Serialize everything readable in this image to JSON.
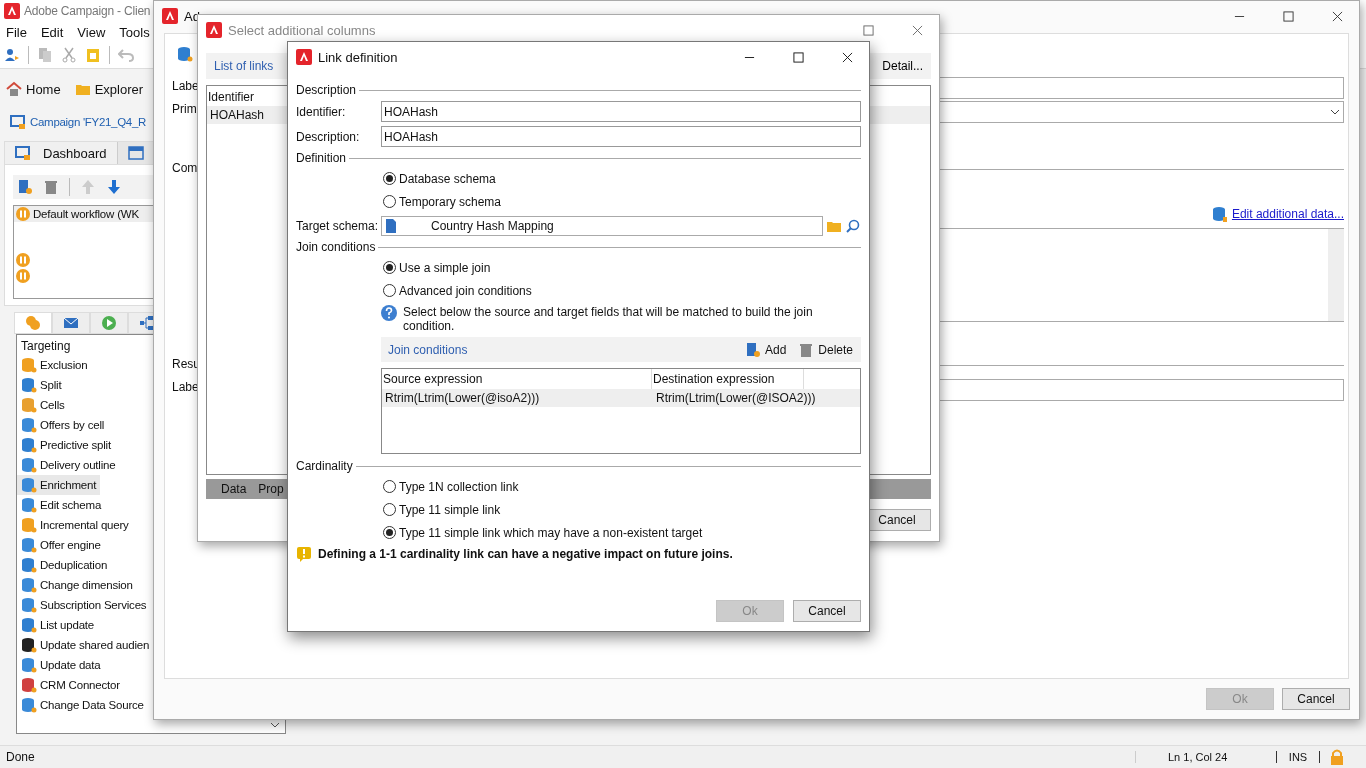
{
  "app": {
    "title": "Adobe Campaign - Clien",
    "menu": [
      {
        "label": "File"
      },
      {
        "label": "Edit"
      },
      {
        "label": "View"
      },
      {
        "label": "Tools"
      }
    ],
    "nav": [
      {
        "label": "Home",
        "kind": "home"
      },
      {
        "label": "Explorer",
        "kind": "folder"
      }
    ],
    "campaign_tab": "Campaign 'FY21_Q4_R",
    "dashboard_tab": "Dashboard",
    "workflows": [
      {
        "label": "Default workflow (WK",
        "selected": true
      }
    ],
    "activity_group": "Targeting",
    "activities": [
      {
        "label": "Exclusion",
        "selected": false
      },
      {
        "label": "Split",
        "selected": false
      },
      {
        "label": "Cells",
        "selected": false
      },
      {
        "label": "Offers by cell",
        "selected": false
      },
      {
        "label": "Predictive split",
        "selected": false
      },
      {
        "label": "Delivery outline",
        "selected": false
      },
      {
        "label": "Enrichment",
        "selected": true
      },
      {
        "label": "Edit schema",
        "selected": false
      },
      {
        "label": "Incremental query",
        "selected": false
      },
      {
        "label": "Offer engine",
        "selected": false
      },
      {
        "label": "Deduplication",
        "selected": false
      },
      {
        "label": "Change dimension",
        "selected": false
      },
      {
        "label": "Subscription Services",
        "selected": false
      },
      {
        "label": "List update",
        "selected": false
      },
      {
        "label": "Update shared audien",
        "selected": false
      },
      {
        "label": "Update data",
        "selected": false
      },
      {
        "label": "CRM Connector",
        "selected": false
      },
      {
        "label": "Change Data Source",
        "selected": false
      }
    ],
    "status_bar": {
      "text": "Done",
      "position": "Ln 1, Col 24",
      "mode": "INS"
    }
  },
  "enrichment_window": {
    "title": "Ad",
    "labels": [
      "Labe",
      "Prim",
      "Com",
      "Resu",
      "Labe"
    ],
    "link": "Edit additional data...",
    "buttons": [
      {
        "label": "Ok",
        "disabled": true
      },
      {
        "label": "Cancel",
        "disabled": false
      }
    ]
  },
  "columns_window": {
    "title": "Select additional columns",
    "tab": "List of links",
    "detail_button": "Detail...",
    "column": "Identifier",
    "rows": [
      {
        "label": "HOAHash",
        "selected": true
      }
    ],
    "bottom_tabs": [
      {
        "label": "Data"
      },
      {
        "label": "Prop"
      }
    ],
    "cancel": "Cancel"
  },
  "link_window": {
    "title": "Link definition",
    "description_section": "Description",
    "fields": [
      {
        "label": "Identifier:",
        "value": "HOAHash"
      },
      {
        "label": "Description:",
        "value": "HOAHash"
      }
    ],
    "definition_section": "Definition",
    "definition_options": [
      {
        "label": "Database schema",
        "selected": true
      },
      {
        "label": "Temporary schema",
        "selected": false
      }
    ],
    "target_schema": {
      "label": "Target schema:",
      "value": "Country Hash Mapping"
    },
    "join_section": "Join conditions",
    "join_options": [
      {
        "label": "Use a simple join",
        "selected": true
      },
      {
        "label": "Advanced join conditions",
        "selected": false
      }
    ],
    "help": "Select below the source and target fields that will be matched to build the join condition.",
    "join_tab": "Join conditions",
    "add": "Add",
    "delete": "Delete",
    "table": {
      "columns": [
        "Source expression",
        "Destination expression"
      ],
      "rows": [
        {
          "cells": [
            "Rtrim(Ltrim(Lower(@isoA2)))",
            "Rtrim(Ltrim(Lower(@ISOA2)))"
          ],
          "selected": true
        }
      ]
    },
    "cardinality_section": "Cardinality",
    "cardinality_options": [
      {
        "label": "Type 1N collection link",
        "selected": false
      },
      {
        "label": "Type 11 simple link",
        "selected": false
      },
      {
        "label": "Type 11 simple link which may have a non-existent target",
        "selected": true
      }
    ],
    "warning": "Defining a 1-1 cardinality link can have a negative impact on future joins.",
    "buttons": [
      {
        "label": "Ok",
        "disabled": true
      },
      {
        "label": "Cancel",
        "disabled": false
      }
    ]
  }
}
